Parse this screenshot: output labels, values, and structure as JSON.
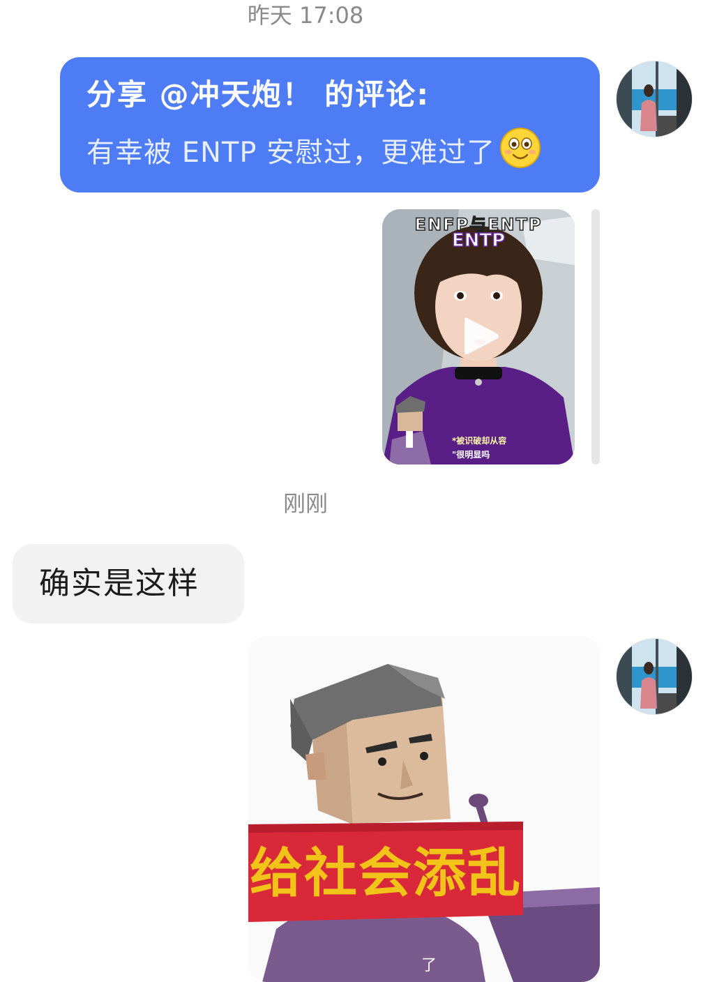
{
  "timestamps": {
    "yesterday": "昨天 17:08",
    "just_now": "刚刚"
  },
  "share": {
    "title": "分享 @冲天炮！ 的评论:",
    "comment": "有幸被 ENTP 安慰过，更难过了",
    "emoji_icon": "grinning-face-icon"
  },
  "video": {
    "title_line1": "ENFP与ENTP",
    "title_line2": "ENTP",
    "caption_line1": "*被识破却从容",
    "caption_line2": "\"很明显吗",
    "play_icon": "play-icon"
  },
  "reply": {
    "text": "确实是这样"
  },
  "sticker": {
    "banner": "给社会添乱",
    "small_text": "了"
  },
  "colors": {
    "share_bubble": "#4d7cf5",
    "reply_bubble": "#f2f2f2",
    "banner_red": "#d9283a",
    "banner_text": "#f2c318",
    "shirt_purple": "#5a1f86"
  }
}
